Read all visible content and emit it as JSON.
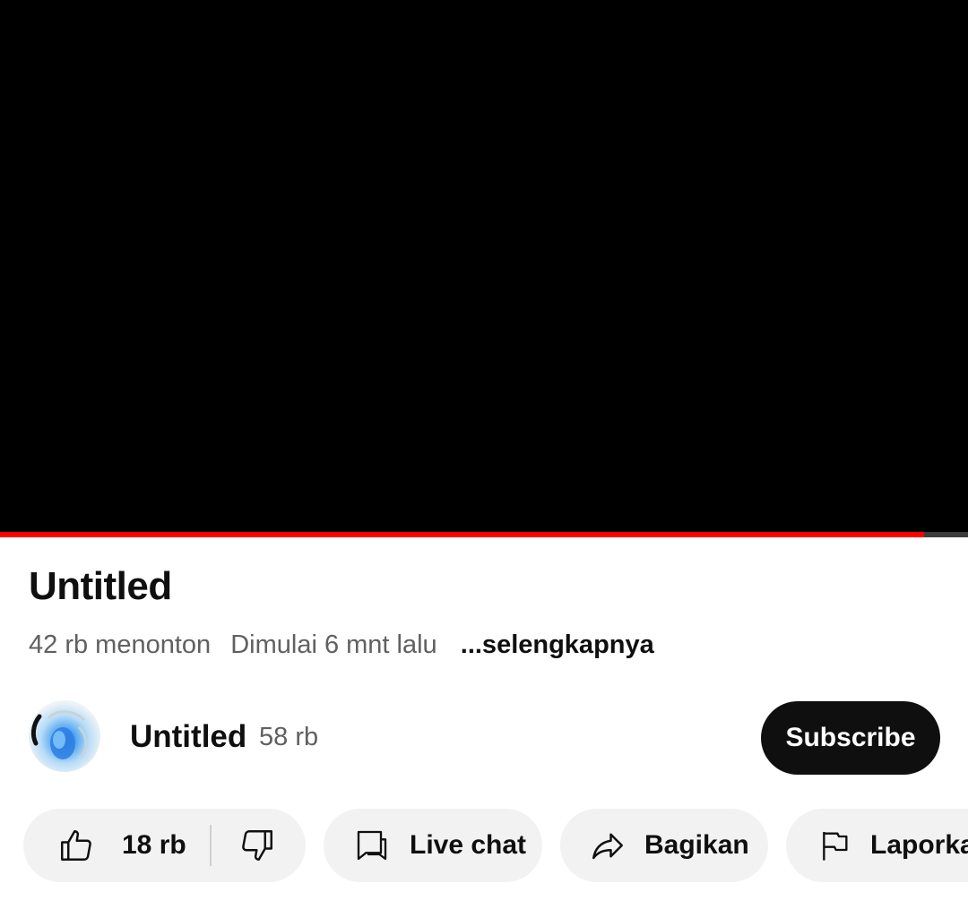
{
  "player": {
    "progress_fraction": 0.955
  },
  "video": {
    "title": "Untitled",
    "viewers": "42 rb menonton",
    "started": "Dimulai 6 mnt lalu",
    "more_label": "...selengkapnya"
  },
  "channel": {
    "name": "Untitled",
    "subscribers": "58 rb",
    "subscribe_label": "Subscribe"
  },
  "actions": {
    "like_count": "18 rb",
    "live_chat_label": "Live chat",
    "share_label": "Bagikan",
    "report_label": "Laporkan"
  },
  "icons": {
    "like": "thumbs-up-icon",
    "dislike": "thumbs-down-icon",
    "chat": "chat-icon",
    "share": "share-icon",
    "report": "flag-icon"
  },
  "colors": {
    "progress": "#ff0000",
    "subscribe_bg": "#0f0f0f",
    "pill_bg": "#f2f2f2"
  }
}
